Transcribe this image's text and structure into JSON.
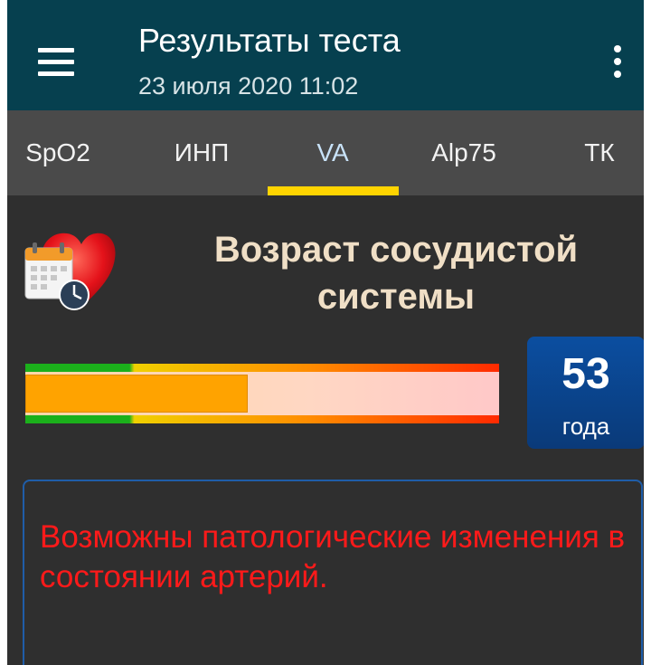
{
  "appbar": {
    "title": "Результаты теста",
    "subtitle": "23 июля 2020  11:02",
    "menu_icon": "hamburger-menu-icon",
    "more_icon": "more-vertical-icon",
    "background": "#06404f"
  },
  "tabs": {
    "items": [
      {
        "label": "SpO2",
        "active": false
      },
      {
        "label": "ИНП",
        "active": false
      },
      {
        "label": "VA",
        "active": true
      },
      {
        "label": "Alp75",
        "active": false
      },
      {
        "label": "ТК",
        "active": false
      }
    ],
    "indicator_color": "#ffd400"
  },
  "section": {
    "icon": "heart-calendar-clock-icon",
    "title_line1": "Возраст сосудистой",
    "title_line2": "системы"
  },
  "meter": {
    "fill_percent": 47,
    "fill_color": "#ffa300",
    "scale_colors": [
      "#1bb01b",
      "#f0d000",
      "#ff8c00",
      "#ff2a00"
    ]
  },
  "age": {
    "value": "53",
    "unit": "года",
    "background": "#0b4ea0"
  },
  "message": {
    "text": "Возможны патологические изменения в состоянии артерий.",
    "color": "#ff1a1a"
  }
}
